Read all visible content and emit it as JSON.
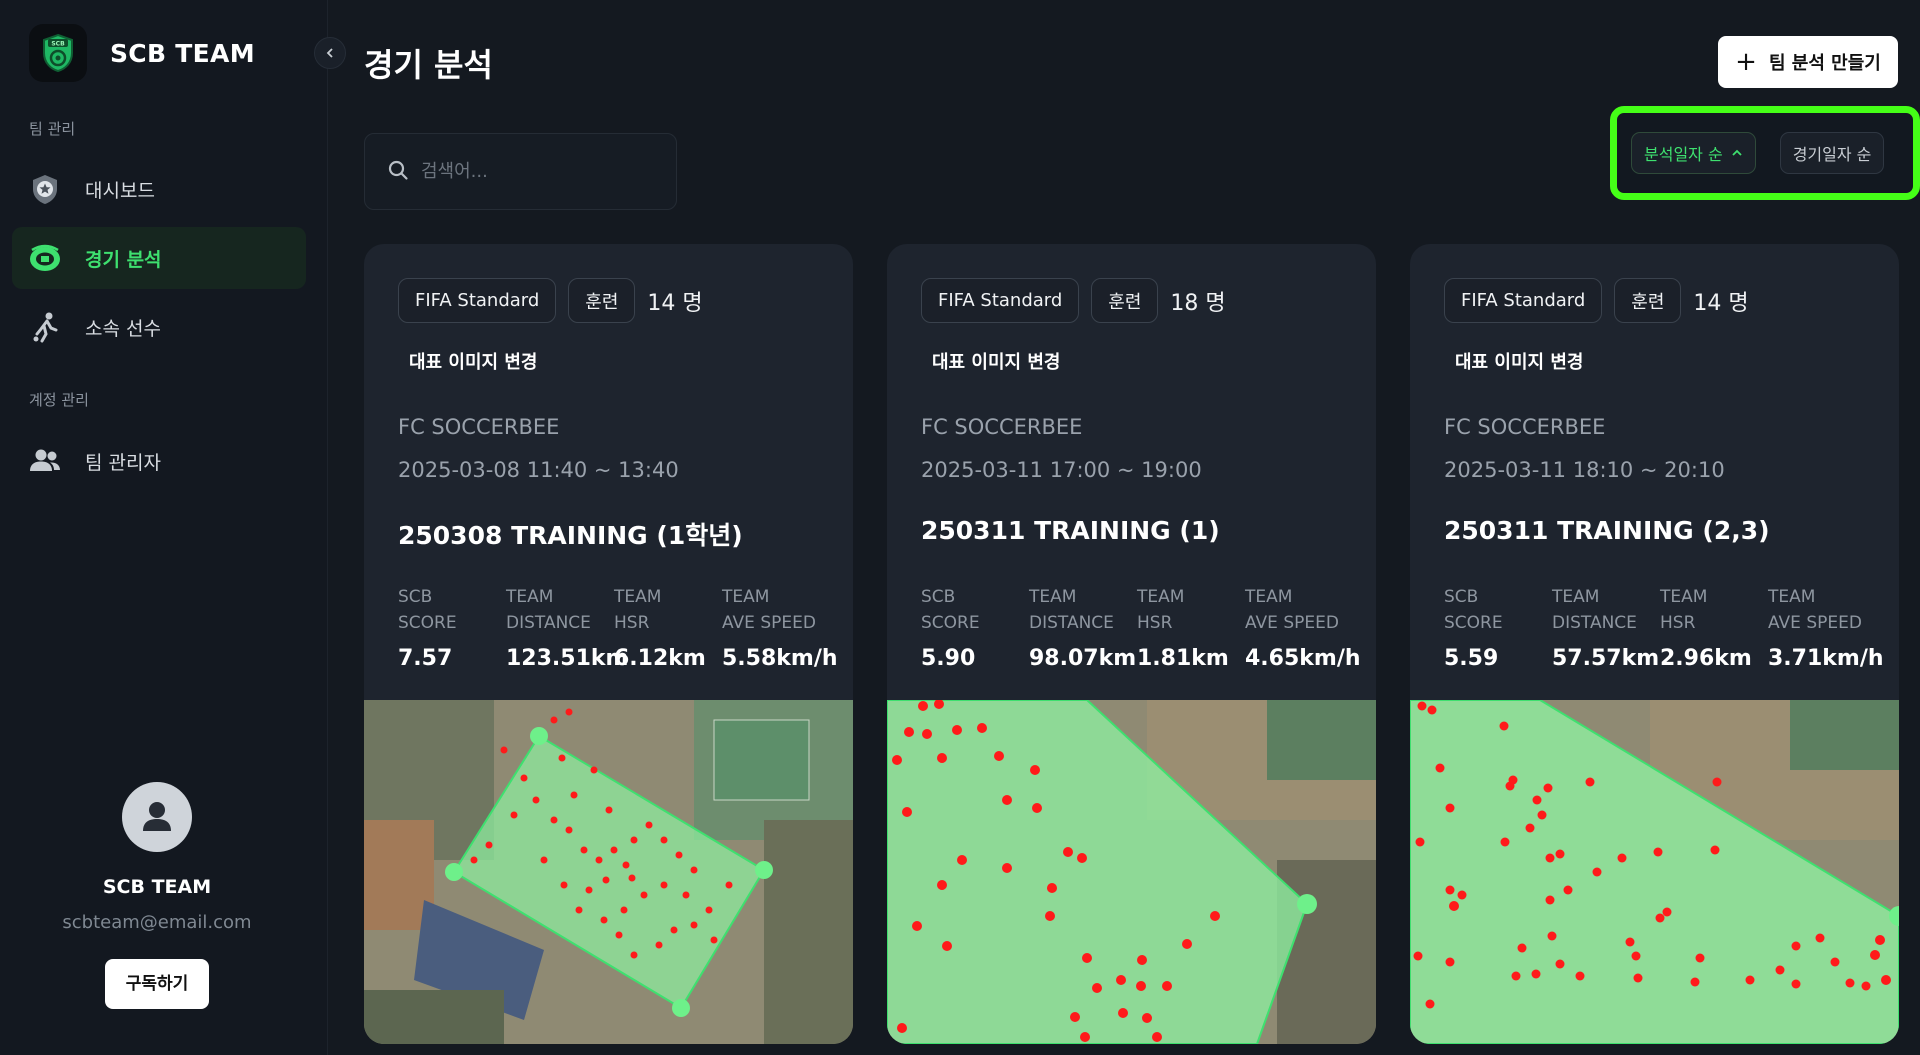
{
  "brand": {
    "name": "SCB TEAM",
    "logo_text": "SCB"
  },
  "sidebar": {
    "sections": [
      {
        "label": "팀 관리"
      },
      {
        "label": "계정 관리"
      }
    ],
    "items": [
      {
        "label": "대시보드",
        "icon": "shield-star-icon"
      },
      {
        "label": "경기 분석",
        "icon": "stadium-icon",
        "active": true
      },
      {
        "label": "소속 선수",
        "icon": "player-kick-icon"
      },
      {
        "label": "팀 관리자",
        "icon": "users-icon"
      }
    ],
    "profile": {
      "name": "SCB TEAM",
      "email": "scbteam@email.com",
      "subscribe_label": "구독하기"
    }
  },
  "header": {
    "title": "경기 분석",
    "create_label": "팀 분석 만들기"
  },
  "search": {
    "placeholder": "검색어..."
  },
  "sort": {
    "options": [
      {
        "label": "분석일자 순",
        "active": true,
        "direction": "ascending"
      },
      {
        "label": "경기일자 순",
        "active": false
      }
    ],
    "highlight_color": "#45ff17"
  },
  "cards": [
    {
      "standard": "FIFA Standard",
      "type": "훈련",
      "members": "14 명",
      "change_image_label": "대표 이미지 변경",
      "team": "FC SOCCERBEE",
      "datetime": "2025-03-08 11:40 ~ 13:40",
      "title": "250308 TRAINING (1학년)",
      "stats": [
        {
          "label_1": "SCB",
          "label_2": "SCORE",
          "value": "7.57"
        },
        {
          "label_1": "TEAM",
          "label_2": "DISTANCE",
          "value": "123.51km"
        },
        {
          "label_1": "TEAM",
          "label_2": "HSR",
          "value": "6.12km"
        },
        {
          "label_1": "TEAM",
          "label_2": "AVE SPEED",
          "value": "5.58km/h"
        }
      ]
    },
    {
      "standard": "FIFA Standard",
      "type": "훈련",
      "members": "18 명",
      "change_image_label": "대표 이미지 변경",
      "team": "FC SOCCERBEE",
      "datetime": "2025-03-11 17:00 ~ 19:00",
      "title": "250311 TRAINING (1)",
      "stats": [
        {
          "label_1": "SCB",
          "label_2": "SCORE",
          "value": "5.90"
        },
        {
          "label_1": "TEAM",
          "label_2": "DISTANCE",
          "value": "98.07km"
        },
        {
          "label_1": "TEAM",
          "label_2": "HSR",
          "value": "1.81km"
        },
        {
          "label_1": "TEAM",
          "label_2": "AVE SPEED",
          "value": "4.65km/h"
        }
      ]
    },
    {
      "standard": "FIFA Standard",
      "type": "훈련",
      "members": "14 명",
      "change_image_label": "대표 이미지 변경",
      "team": "FC SOCCERBEE",
      "datetime": "2025-03-11 18:10 ~ 20:10",
      "title": "250311 TRAINING (2,3)",
      "stats": [
        {
          "label_1": "SCB",
          "label_2": "SCORE",
          "value": "5.59"
        },
        {
          "label_1": "TEAM",
          "label_2": "DISTANCE",
          "value": "57.57km"
        },
        {
          "label_1": "TEAM",
          "label_2": "HSR",
          "value": "2.96km"
        },
        {
          "label_1": "TEAM",
          "label_2": "AVE SPEED",
          "value": "3.71km/h"
        }
      ]
    }
  ],
  "colors": {
    "accent": "#3ee06f",
    "background": "#141920",
    "card": "#1e242e",
    "heatmap_dot": "#ff1a1a",
    "field_overlay": "#8ef0a0"
  }
}
